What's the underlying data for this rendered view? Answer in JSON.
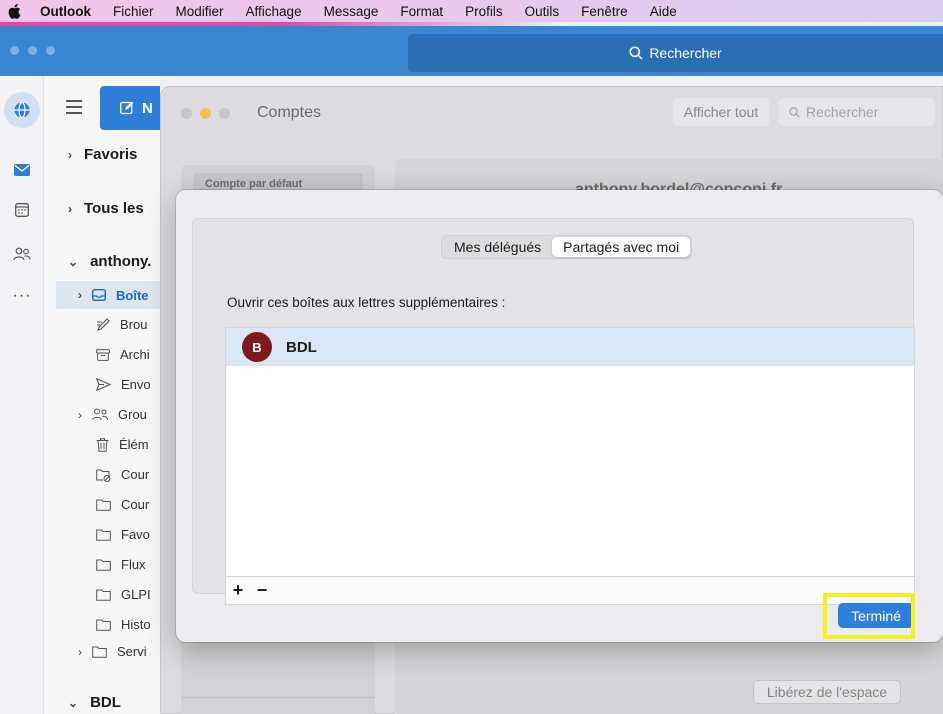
{
  "menubar": {
    "app": "Outlook",
    "items": [
      "Fichier",
      "Modifier",
      "Affichage",
      "Message",
      "Format",
      "Profils",
      "Outils",
      "Fenêtre",
      "Aide"
    ]
  },
  "toolbar": {
    "search_label": "Rechercher"
  },
  "folders": {
    "new_label": "N",
    "favoris": "Favoris",
    "all": "Tous les",
    "account": "anthony.",
    "items": [
      {
        "label": "Boîte",
        "icon": "inbox-icon"
      },
      {
        "label": "Brou",
        "icon": "drafts-icon"
      },
      {
        "label": "Archi",
        "icon": "archive-icon"
      },
      {
        "label": "Envo",
        "icon": "sent-icon"
      },
      {
        "label": "Grou",
        "icon": "groups-icon"
      },
      {
        "label": "Élém",
        "icon": "trash-icon"
      },
      {
        "label": "Cour",
        "icon": "junk-icon"
      },
      {
        "label": "Cour",
        "icon": "folder-icon"
      },
      {
        "label": "Favo",
        "icon": "folder-icon"
      },
      {
        "label": "Flux",
        "icon": "folder-icon"
      },
      {
        "label": "GLPI",
        "icon": "folder-icon"
      },
      {
        "label": "Histo",
        "icon": "folder-icon"
      },
      {
        "label": "Servi",
        "icon": "folder-icon"
      }
    ],
    "bdl": "BDL"
  },
  "accounts_window": {
    "title": "Comptes",
    "show_all": "Afficher tout",
    "search_placeholder": "Rechercher",
    "default_account": "Compte par défaut",
    "email": "anthony.bordel@copconi.fr",
    "free_space": "Libérez de l'espace"
  },
  "sheet": {
    "tabs": [
      "Mes délégués",
      "Partagés avec moi"
    ],
    "active_tab": "Partagés avec moi",
    "open_label": "Ouvrir ces boîtes aux lettres supplémentaires :",
    "mailboxes": [
      {
        "initial": "B",
        "name": "BDL",
        "color": "#7c1a1f"
      }
    ],
    "add_label": "+",
    "remove_label": "−",
    "done_label": "Terminé"
  },
  "colors": {
    "accent": "#2e7fdb",
    "highlight": "#f4f21c",
    "titlebar": "#3b86d1"
  }
}
